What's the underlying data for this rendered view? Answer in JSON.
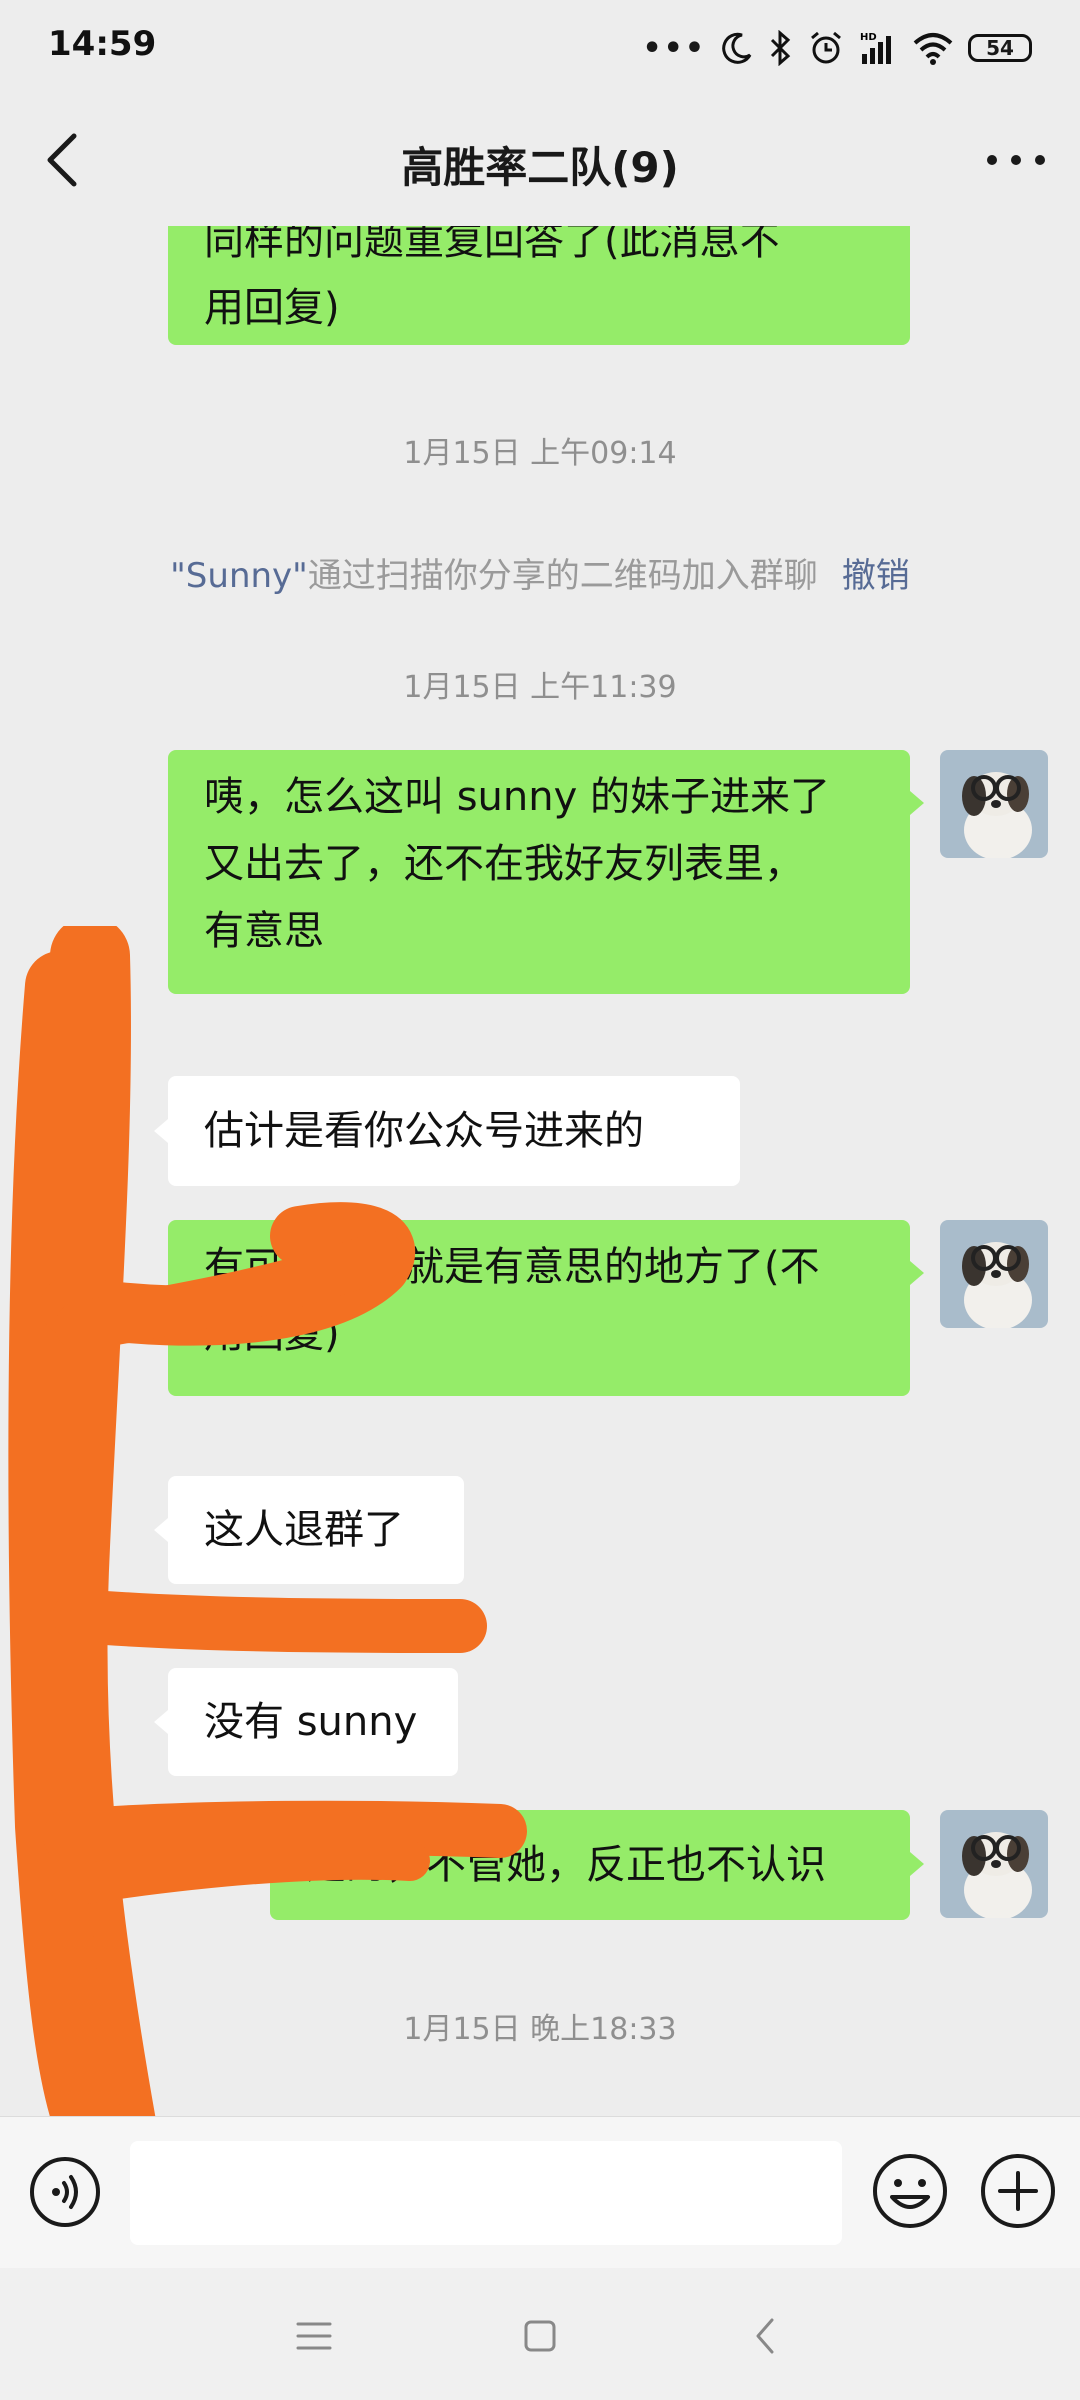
{
  "status": {
    "time": "14:59",
    "battery": "54"
  },
  "header": {
    "title": "高胜率二队(9)"
  },
  "messages": {
    "m0": {
      "line1": "同样的问题重复回答了(此消息不",
      "line2": "用回复)"
    },
    "t1": "1月15日 上午09:14",
    "sys": {
      "name": "\"Sunny\"",
      "text": "通过扫描你分享的二维码加入群聊",
      "action": "撤销"
    },
    "t2": "1月15日 上午11:39",
    "m1": {
      "line1": "咦，怎么这叫 sunny 的妹子进来了",
      "line2": "又出去了，还不在我好友列表里，",
      "line3": "有意思"
    },
    "m2": "估计是看你公众号进来的",
    "m3": {
      "line1": "有可能，这就是有意思的地方了(不",
      "line2": "用回复)"
    },
    "m4": "这人退群了",
    "m5": "没有 sunny",
    "m6": "是的，不管她，反正也不认识",
    "t3": "1月15日 晚上18:33"
  },
  "input": {
    "placeholder": ""
  },
  "colors": {
    "accent_green": "#95ec69",
    "link_blue": "#576b95",
    "background": "#ededed",
    "scribble_orange": "#f37022"
  },
  "icons": {
    "back": "chevron-left-icon",
    "more": "more-dots-icon",
    "voice": "voice-icon",
    "emoji": "emoji-icon",
    "plus": "plus-icon",
    "menu": "menu-icon",
    "home": "home-icon",
    "nav_back": "back-icon"
  }
}
